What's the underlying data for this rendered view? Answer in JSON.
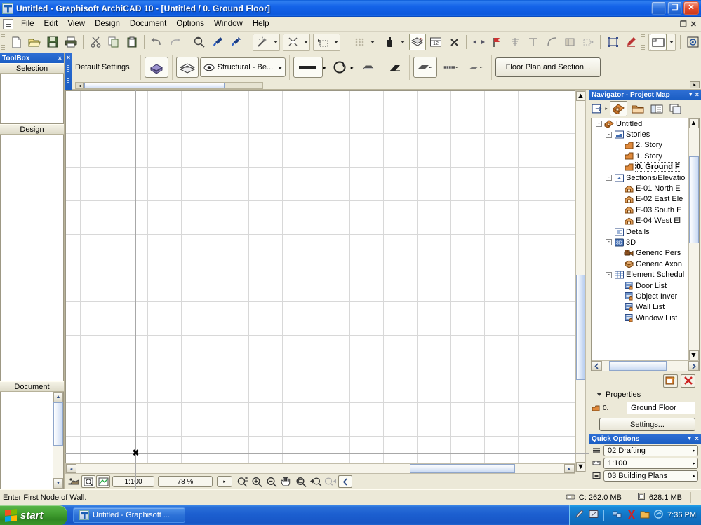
{
  "window": {
    "title": "Untitled - Graphisoft ArchiCAD 10 - [Untitled / 0. Ground Floor]",
    "app_icon": "archicad-icon",
    "minimize_label": "_",
    "maximize_label": "❐",
    "close_label": "✕",
    "mdi_minimize_label": "_",
    "mdi_restore_label": "❐",
    "mdi_close_label": "✕"
  },
  "menu": {
    "doc_icon": "document-icon",
    "items": [
      {
        "label": "File"
      },
      {
        "label": "Edit"
      },
      {
        "label": "View"
      },
      {
        "label": "Design"
      },
      {
        "label": "Document"
      },
      {
        "label": "Options"
      },
      {
        "label": "Window"
      },
      {
        "label": "Help"
      }
    ]
  },
  "toolbar": {
    "buttons": [
      {
        "name": "new-file-button",
        "icon": "new-document-icon",
        "tooltip": "New"
      },
      {
        "name": "open-file-button",
        "icon": "open-folder-icon",
        "tooltip": "Open"
      },
      {
        "name": "save-file-button",
        "icon": "floppy-disk-icon",
        "tooltip": "Save"
      },
      {
        "name": "print-button",
        "icon": "printer-icon",
        "tooltip": "Print"
      },
      {
        "name": "cut-button",
        "icon": "scissors-icon",
        "tooltip": "Cut"
      },
      {
        "name": "copy-button",
        "icon": "copy-pages-icon",
        "tooltip": "Copy"
      },
      {
        "name": "paste-button",
        "icon": "clipboard-icon",
        "tooltip": "Paste"
      },
      {
        "name": "undo-button",
        "icon": "undo-arrow-icon",
        "tooltip": "Undo"
      },
      {
        "name": "redo-button",
        "icon": "redo-arrow-icon",
        "tooltip": "Redo"
      },
      {
        "name": "find-select-button",
        "icon": "magnifier-select-icon",
        "tooltip": "Find & Select"
      },
      {
        "name": "pick-up-params-button",
        "icon": "eyedropper-icon",
        "tooltip": "Pick Up Parameters"
      },
      {
        "name": "inject-params-button",
        "icon": "syringe-icon",
        "tooltip": "Inject Parameters"
      },
      {
        "name": "magic-wand-button",
        "icon": "magic-wand-icon",
        "tooltip": "Magic Wand"
      },
      {
        "name": "trim-button",
        "icon": "trim-scissor-icon",
        "tooltip": "Trim"
      },
      {
        "name": "offset-button",
        "icon": "offset-icon",
        "tooltip": "Offset"
      },
      {
        "name": "mesh-button",
        "icon": "grid-dots-icon",
        "tooltip": "Mesh"
      },
      {
        "name": "paint-button",
        "icon": "paint-bottle-icon",
        "tooltip": "Paint"
      },
      {
        "name": "layers-button",
        "icon": "layers-icon",
        "tooltip": "Layer Settings"
      },
      {
        "name": "dimension-button",
        "icon": "dimension-ruler-icon",
        "tooltip": "Dimensions"
      },
      {
        "name": "group-button",
        "icon": "group-x-icon",
        "tooltip": "Group"
      },
      {
        "name": "mirror-button",
        "icon": "mirror-icon",
        "tooltip": "Mirror"
      },
      {
        "name": "rotate-button",
        "icon": "rotate-flag-icon",
        "tooltip": "Rotate"
      },
      {
        "name": "elevate-button",
        "icon": "elevate-icon",
        "tooltip": "Elevate"
      },
      {
        "name": "align-button",
        "icon": "align-corner-icon",
        "tooltip": "Align"
      },
      {
        "name": "fillet-button",
        "icon": "fillet-arc-icon",
        "tooltip": "Fillet/Chamfer"
      },
      {
        "name": "multiply-button",
        "icon": "multiply-icon",
        "tooltip": "Multiply"
      },
      {
        "name": "drag-copy-button",
        "icon": "drag-copy-icon",
        "tooltip": "Drag a Copy"
      },
      {
        "name": "marquee-button",
        "icon": "marquee-icon",
        "tooltip": "Marquee"
      },
      {
        "name": "annotate-button",
        "icon": "pen-stamp-icon",
        "tooltip": "Annotate"
      },
      {
        "name": "window-layout-button",
        "icon": "window-layout-icon",
        "tooltip": "Window Layout"
      },
      {
        "name": "navigator-toggle-button",
        "icon": "navigator-palette-icon",
        "tooltip": "Navigator"
      }
    ]
  },
  "infobox": {
    "title": "Default Settings",
    "close_label": "×",
    "tool_icon": "wall-tool-icon",
    "layer_icon": "layers-stack-icon",
    "layer_combo": {
      "label": "Structural - Be...",
      "eye_icon": "eye-icon",
      "arrow": "▸"
    },
    "pen_button": {
      "icon": "pen-thickness-icon",
      "arrow": "▸"
    },
    "material_button": {
      "icon": "material-circle-icon",
      "arrow": "▸"
    },
    "fill_button": {
      "icon": "fill-hatch-icon"
    },
    "corner_button": {
      "icon": "wall-corner-icon"
    },
    "geometry_methods": [
      {
        "name": "geometry-straight-wall",
        "icon": "straight-wall-icon",
        "active": true
      },
      {
        "name": "geometry-chained-wall",
        "icon": "chained-wall-icon",
        "active": false
      },
      {
        "name": "geometry-curved-wall",
        "icon": "curved-wall-icon",
        "active": false
      }
    ],
    "floor_plan_button": "Floor Plan and Section...",
    "scroll_left": "◂",
    "scroll_right": "▸",
    "expand_arrow": "▸"
  },
  "toolbox": {
    "title": "ToolBox",
    "close_label": "×",
    "sections": [
      {
        "label": "Selection"
      },
      {
        "label": "Design"
      },
      {
        "label": "Document"
      }
    ],
    "scroll_up": "▲",
    "scroll_down": "▼"
  },
  "canvas": {
    "scale_value": "1:100",
    "zoom_value": "78 %",
    "bottom_buttons": [
      {
        "name": "3d-view-button",
        "icon": "3d-house-icon"
      },
      {
        "name": "zoom-detail-button",
        "icon": "magnifier-page-icon"
      },
      {
        "name": "publish-button",
        "icon": "publish-icon"
      }
    ],
    "zoom_tools": [
      {
        "name": "zoom-scale-button",
        "icon": "zoom-plusminus-icon"
      },
      {
        "name": "zoom-in-button",
        "icon": "zoom-in-icon"
      },
      {
        "name": "zoom-out-button",
        "icon": "zoom-out-icon"
      },
      {
        "name": "pan-button",
        "icon": "hand-pan-icon"
      },
      {
        "name": "fit-in-window-button",
        "icon": "fit-window-icon"
      },
      {
        "name": "previous-zoom-button",
        "icon": "zoom-previous-icon"
      },
      {
        "name": "next-zoom-button",
        "icon": "zoom-next-icon"
      },
      {
        "name": "collapse-button",
        "icon": "chevron-left-icon"
      }
    ],
    "dropdown_arrow": "▸",
    "scroll_left": "◂",
    "scroll_right": "▸",
    "scroll_up": "▲",
    "scroll_down": "▼",
    "cursor_glyph": "✖"
  },
  "navigator": {
    "title": "Navigator - Project Map",
    "dropdown_label": "▼",
    "close_label": "×",
    "toolbar": [
      {
        "name": "navigator-organizer-button",
        "icon": "organizer-arrow-icon",
        "active": false
      },
      {
        "name": "project-map-button",
        "icon": "project-map-house-icon",
        "active": true
      },
      {
        "name": "view-map-button",
        "icon": "view-map-folder-icon",
        "active": false
      },
      {
        "name": "layout-book-button",
        "icon": "layout-book-icon",
        "active": false
      },
      {
        "name": "publisher-sets-button",
        "icon": "publisher-sets-icon",
        "active": false
      }
    ],
    "tree": [
      {
        "label": "Untitled",
        "depth": 0,
        "expander": "-",
        "icon": "project-house-icon",
        "selected": false
      },
      {
        "label": "Stories",
        "depth": 1,
        "expander": "-",
        "icon": "stories-icon",
        "selected": false
      },
      {
        "label": "2. Story",
        "depth": 2,
        "expander": "",
        "icon": "story-icon",
        "selected": false
      },
      {
        "label": "1. Story",
        "depth": 2,
        "expander": "",
        "icon": "story-icon",
        "selected": false
      },
      {
        "label": "0. Ground F",
        "depth": 2,
        "expander": "",
        "icon": "story-icon",
        "selected": true
      },
      {
        "label": "Sections/Elevatio",
        "depth": 1,
        "expander": "-",
        "icon": "sections-icon",
        "selected": false
      },
      {
        "label": "E-01 North E",
        "depth": 2,
        "expander": "",
        "icon": "elevation-icon",
        "selected": false
      },
      {
        "label": "E-02 East Ele",
        "depth": 2,
        "expander": "",
        "icon": "elevation-icon",
        "selected": false
      },
      {
        "label": "E-03 South E",
        "depth": 2,
        "expander": "",
        "icon": "elevation-icon",
        "selected": false
      },
      {
        "label": "E-04 West El",
        "depth": 2,
        "expander": "",
        "icon": "elevation-icon",
        "selected": false
      },
      {
        "label": "Details",
        "depth": 1,
        "expander": "",
        "icon": "details-icon",
        "selected": false
      },
      {
        "label": "3D",
        "depth": 1,
        "expander": "-",
        "icon": "3d-icon",
        "selected": false
      },
      {
        "label": "Generic Pers",
        "depth": 2,
        "expander": "",
        "icon": "camera-icon",
        "selected": false
      },
      {
        "label": "Generic Axon",
        "depth": 2,
        "expander": "",
        "icon": "axonometry-box-icon",
        "selected": false
      },
      {
        "label": "Element Schedul",
        "depth": 1,
        "expander": "-",
        "icon": "schedule-table-icon",
        "selected": false
      },
      {
        "label": "Door List",
        "depth": 2,
        "expander": "",
        "icon": "list-icon",
        "selected": false
      },
      {
        "label": "Object Inver",
        "depth": 2,
        "expander": "",
        "icon": "list-icon",
        "selected": false
      },
      {
        "label": "Wall List",
        "depth": 2,
        "expander": "",
        "icon": "list-icon",
        "selected": false
      },
      {
        "label": "Window List",
        "depth": 2,
        "expander": "",
        "icon": "list-icon",
        "selected": false
      }
    ],
    "actions": [
      {
        "name": "new-story-button",
        "icon": "new-item-icon"
      },
      {
        "name": "delete-story-button",
        "icon": "delete-x-icon"
      }
    ],
    "properties": {
      "heading": "Properties",
      "collapse_arrow": "▼",
      "story_icon": "story-small-icon",
      "number": "0.",
      "name_value": "Ground Floor",
      "settings_button": "Settings..."
    }
  },
  "quick_options": {
    "title": "Quick Options",
    "dropdown_label": "▼",
    "close_label": "×",
    "rows": [
      {
        "name": "layer-combination-select",
        "icon": "layers-small-icon",
        "value": "02 Drafting",
        "arrow": "▸"
      },
      {
        "name": "scale-select",
        "icon": "scale-small-icon",
        "value": "1:100",
        "arrow": "▸"
      },
      {
        "name": "model-view-select",
        "icon": "modelview-icon",
        "value": "03 Building Plans",
        "arrow": "▸"
      }
    ]
  },
  "statusbar": {
    "message": "Enter First Node of Wall.",
    "disk_icon": "disk-drive-icon",
    "disk_free": "C: 262.0 MB",
    "memory_icon": "memory-chip-icon",
    "memory_free": "628.1 MB"
  },
  "taskbar": {
    "start_label": "start",
    "start_logo": "windows-flag-icon",
    "tasks": [
      {
        "name": "taskbar-item-archicad",
        "icon": "archicad-icon",
        "label": "Untitled - Graphisoft ..."
      }
    ],
    "tray_icons": [
      {
        "name": "tray-pen-icon"
      },
      {
        "name": "tray-tablet-icon"
      },
      {
        "name": "tray-network-icon"
      },
      {
        "name": "tray-kaspersky-icon"
      },
      {
        "name": "tray-folder-icon"
      },
      {
        "name": "tray-sound-icon"
      }
    ],
    "clock": "7:36 PM"
  },
  "colors": {
    "title_blue": "#1463e8",
    "chrome": "#ece9d8",
    "canvas_white": "#ffffff",
    "grid_line": "#d8d8d8",
    "selection_orange": "#cc6600",
    "taskbar_blue": "#1c5fd0",
    "start_green": "#3f9c2f"
  }
}
